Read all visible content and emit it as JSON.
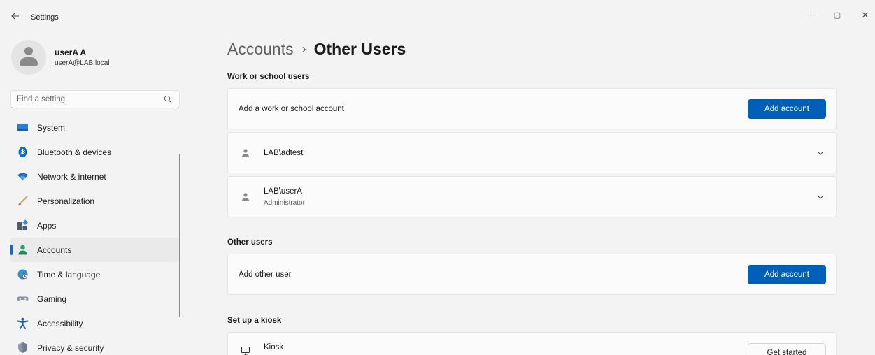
{
  "window": {
    "title": "Settings",
    "back_icon": "back-arrow-icon",
    "controls": {
      "minimize": "−",
      "maximize": "▢",
      "close": "✕"
    }
  },
  "profile": {
    "name": "userA A",
    "email": "userA@LAB.local"
  },
  "search": {
    "placeholder": "Find a setting"
  },
  "sidebar": {
    "items": [
      {
        "label": "System",
        "icon": "monitor-icon",
        "active": false
      },
      {
        "label": "Bluetooth & devices",
        "icon": "bluetooth-icon",
        "active": false
      },
      {
        "label": "Network & internet",
        "icon": "wifi-icon",
        "active": false
      },
      {
        "label": "Personalization",
        "icon": "brush-icon",
        "active": false
      },
      {
        "label": "Apps",
        "icon": "apps-icon",
        "active": false
      },
      {
        "label": "Accounts",
        "icon": "person-icon",
        "active": true
      },
      {
        "label": "Time & language",
        "icon": "globe-clock-icon",
        "active": false
      },
      {
        "label": "Gaming",
        "icon": "gamepad-icon",
        "active": false
      },
      {
        "label": "Accessibility",
        "icon": "accessibility-icon",
        "active": false
      },
      {
        "label": "Privacy & security",
        "icon": "shield-icon",
        "active": false
      }
    ]
  },
  "breadcrumb": {
    "parent": "Accounts",
    "separator": "›",
    "current": "Other Users"
  },
  "work_school": {
    "title": "Work or school users",
    "add_label": "Add a work or school account",
    "add_button": "Add account",
    "users": [
      {
        "name": "LAB\\adtest",
        "role": ""
      },
      {
        "name": "LAB\\userA",
        "role": "Administrator"
      }
    ]
  },
  "other_users": {
    "title": "Other users",
    "add_label": "Add other user",
    "add_button": "Add account"
  },
  "kiosk": {
    "title": "Set up a kiosk",
    "label": "Kiosk",
    "button": "Get started"
  },
  "colors": {
    "accent": "#005fb8",
    "window_bg": "#f3f3f3",
    "card_bg": "#fbfbfb"
  }
}
